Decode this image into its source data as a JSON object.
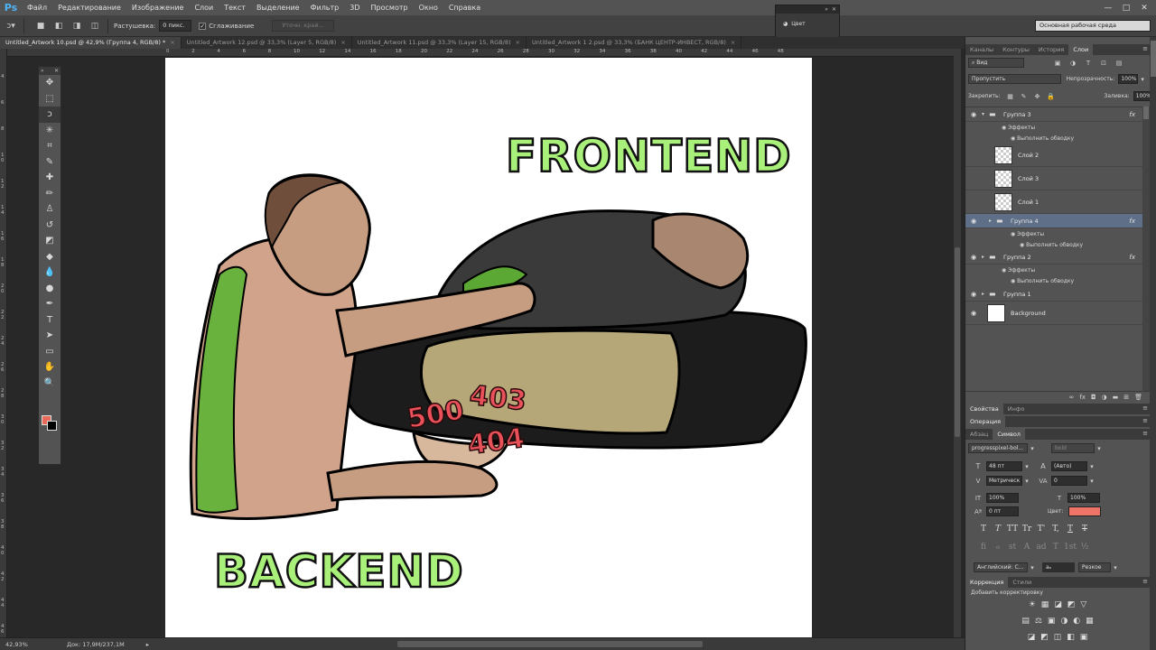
{
  "app": {
    "logo": "Ps"
  },
  "menu": [
    "Файл",
    "Редактирование",
    "Изображение",
    "Слои",
    "Текст",
    "Выделение",
    "Фильтр",
    "3D",
    "Просмотр",
    "Окно",
    "Справка"
  ],
  "window_controls": [
    "—",
    "□",
    "✕"
  ],
  "options": {
    "feather_label": "Растушевка:",
    "feather_value": "0 пикс.",
    "antialias_label": "Сглаживание",
    "refine_button": "Уточн. край...",
    "workspace": "Основная рабочая среда"
  },
  "color_float": {
    "label": "Цвет"
  },
  "tabs": [
    {
      "label": "Untitled_Artwork 10.psd @ 42,9% (Группа 4, RGB/8) *",
      "active": true
    },
    {
      "label": "Untitled_Artwork 12.psd @ 33,3% (Layer 5, RGB/8)",
      "active": false
    },
    {
      "label": "Untitled_Artwork 11.psd @ 33,3% (Layer 15, RGB/8)",
      "active": false
    },
    {
      "label": "Untitled_Artwork 1 2.psd @ 33,3% (БАНК ЦЕНТР-ИНВЕСТ, RGB/8)",
      "active": false
    }
  ],
  "ruler_top": [
    "0",
    "2",
    "4",
    "6",
    "8",
    "10",
    "12",
    "14",
    "16",
    "18",
    "20",
    "22",
    "24",
    "26",
    "28",
    "30",
    "32",
    "34",
    "36",
    "38",
    "40",
    "42",
    "44",
    "46",
    "48"
  ],
  "ruler_left": [
    "4",
    "6",
    "8",
    "1 0",
    "1 2",
    "1 4",
    "1 6",
    "1 8",
    "2 0",
    "2 2",
    "2 4",
    "2 6",
    "2 8",
    "3 0",
    "3 2",
    "3 4",
    "3 6",
    "3 8",
    "4 0",
    "4 2",
    "4 4",
    "4 6"
  ],
  "artwork": {
    "frontend": "FRONTEND",
    "backend": "BACKEND",
    "err_500": "500",
    "err_403": "403",
    "err_404": "404",
    "colors": {
      "green_text": "#a8f07a",
      "error_red": "#e8505a"
    }
  },
  "status": {
    "zoom": "42,93%",
    "doc": "Док: 17,9M/237,1M"
  },
  "tools": [
    "move-tool",
    "marquee-tool",
    "lasso-tool",
    "magic-wand-tool",
    "crop-tool",
    "eyedropper-tool",
    "healing-brush-tool",
    "brush-tool",
    "clone-stamp-tool",
    "history-brush-tool",
    "eraser-tool",
    "paint-bucket-tool",
    "blur-tool",
    "dodge-tool",
    "pen-tool",
    "type-tool",
    "path-selection-tool",
    "rectangle-tool",
    "hand-tool",
    "zoom-tool"
  ],
  "tool_glyphs": [
    "✥",
    "⬚",
    "ↄ",
    "✳",
    "⌗",
    "✎",
    "✚",
    "✏",
    "♙",
    "↺",
    "◩",
    "◆",
    "💧",
    "●",
    "✒",
    "T",
    "➤",
    "▭",
    "✋",
    "🔍"
  ],
  "layers_panel": {
    "tabs": [
      "Каналы",
      "Контуры",
      "История",
      "Слои"
    ],
    "kind_filter": "Вид",
    "blend_mode": "Пропустить",
    "opacity_label": "Непрозрачность:",
    "opacity_value": "100%",
    "lock_label": "Закрепить:",
    "fill_label": "Заливка:",
    "fill_value": "100%",
    "effects_label": "Эффекты",
    "stroke_label": "Выполнить обводку",
    "layers": [
      {
        "name": "Группа 3",
        "kind": "group",
        "visible": true,
        "expanded": true,
        "fx": "fx"
      },
      {
        "name": "Слой 2",
        "kind": "layer",
        "visible": false
      },
      {
        "name": "Слой 3",
        "kind": "layer",
        "visible": false
      },
      {
        "name": "Слой 1",
        "kind": "layer",
        "visible": false
      },
      {
        "name": "Группа 4",
        "kind": "group",
        "visible": true,
        "expanded": false,
        "selected": true,
        "fx": "fx"
      },
      {
        "name": "Группа 2",
        "kind": "group",
        "visible": true,
        "expanded": false,
        "fx": "fx"
      },
      {
        "name": "Группа 1",
        "kind": "group",
        "visible": true,
        "expanded": false
      },
      {
        "name": "Background",
        "kind": "layer",
        "visible": true
      }
    ]
  },
  "properties_tabs": [
    "Свойства",
    "Инфо"
  ],
  "operation_tab": "Операция",
  "char_tabs": [
    "Абзац",
    "Символ"
  ],
  "character": {
    "font_family": "progresspixel-bol...",
    "font_style": "bold",
    "size": "48 пт",
    "leading": "(Авто)",
    "kerning": "Метрическ",
    "tracking": "0",
    "vscale": "100%",
    "hscale": "100%",
    "baseline": "0 пт",
    "color_label": "Цвет:",
    "color": "#ee7468",
    "language": "Английский: С...",
    "antialias": "Резкое",
    "style_glyphs": [
      "T",
      "T",
      "TT",
      "Tr",
      "T'",
      "T,",
      "T",
      "T"
    ],
    "ot_glyphs": [
      "fi",
      "ℴ",
      "st",
      "A",
      "ad",
      "T",
      "1st",
      "½"
    ]
  },
  "adjust_tabs": [
    "Коррекция",
    "Стили"
  ],
  "adjust_title": "Добавить корректировку",
  "adjust_row1": [
    "☀",
    "▦",
    "◪",
    "◩",
    "▽"
  ],
  "adjust_row2": [
    "▤",
    "⚖",
    "▣",
    "◑",
    "◐",
    "▦"
  ],
  "adjust_row3": [
    "◪",
    "◩",
    "◫",
    "◧",
    "▣"
  ]
}
